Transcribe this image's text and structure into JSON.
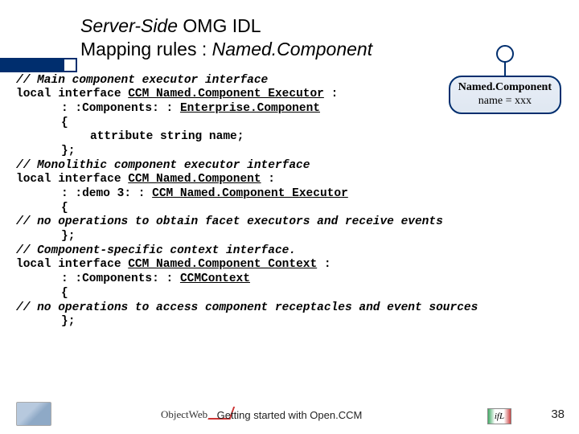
{
  "title": {
    "line1a": "Server-Side",
    "line1b": " OMG IDL",
    "line2a": "Mapping rules : ",
    "line2b": "Named.Component"
  },
  "uml": {
    "name": "Named.Component",
    "attr": "name = xxx"
  },
  "code": {
    "l1": "// Main component executor interface",
    "l2a": "local interface ",
    "l2b": "CCM_Named.Component_Executor",
    "l2c": " :",
    "l3a": ": :Components: : ",
    "l3b": "Enterprise.Component",
    "l4": "{",
    "l5": "attribute string name;",
    "l6": "};",
    "l7": "// Monolithic component executor interface",
    "l8a": "local interface ",
    "l8b": "CCM_Named.Component",
    "l8c": " :",
    "l9a": ": :demo 3: : ",
    "l9b": "CCM_Named.Component_Executor",
    "l10": "{",
    "l11": "// no operations to obtain facet executors and receive events",
    "l12": "};",
    "l13": "// Component-specific context interface.",
    "l14a": "local interface ",
    "l14b": "CCM_Named.Component_Context",
    "l14c": " :",
    "l15a": ": :Components: : ",
    "l15b": "CCMContext",
    "l16": "{",
    "l17": "// no operations to access component receptacles and event sources",
    "l18": "};"
  },
  "footer": {
    "ow": "ObjectWeb",
    "text": "Getting started with Open.CCM",
    "ifl": "ifL",
    "page": "38"
  }
}
